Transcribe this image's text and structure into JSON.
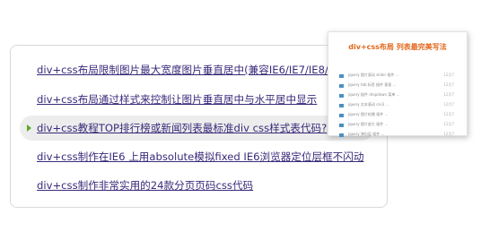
{
  "links": [
    {
      "label": "div+css布局限制图片最大宽度图片垂直居中(兼容IE6/IE7/IE8/",
      "active": false
    },
    {
      "label": "div+css布局通过样式来控制让图片垂直居中与水平居中显示",
      "active": false
    },
    {
      "label": "div+css教程TOP排行榜或新闻列表最标准div css样式表代码?",
      "active": true
    },
    {
      "label": "div+css制作在IE6 上用absolute模拟fixed IE6浏览器定位层框不闪动",
      "active": false
    },
    {
      "label": "div+css制作非常实用的24款分页页码css代码",
      "active": false
    }
  ],
  "preview": {
    "title": "div+css布局 列表最完美写法",
    "accent": "#e2671a",
    "rows": [
      {
        "text": "jquery 图片滚动 slider 插件 …",
        "date": "12月7"
      },
      {
        "text": "jquery tab 标签 插件 垂直 …",
        "date": "12月7"
      },
      {
        "text": "jquery 插件 dropdown 菜单 …",
        "date": "12月7"
      },
      {
        "text": "jquery 文本滚动 css3 …",
        "date": "12月7"
      },
      {
        "text": "jquery 图片轮播 插件 …",
        "date": "12月7"
      },
      {
        "text": "jquery 图片放大 插件 …",
        "date": "12月7"
      },
      {
        "text": "jquery 弹出层 插件 …",
        "date": "12月7"
      }
    ]
  }
}
